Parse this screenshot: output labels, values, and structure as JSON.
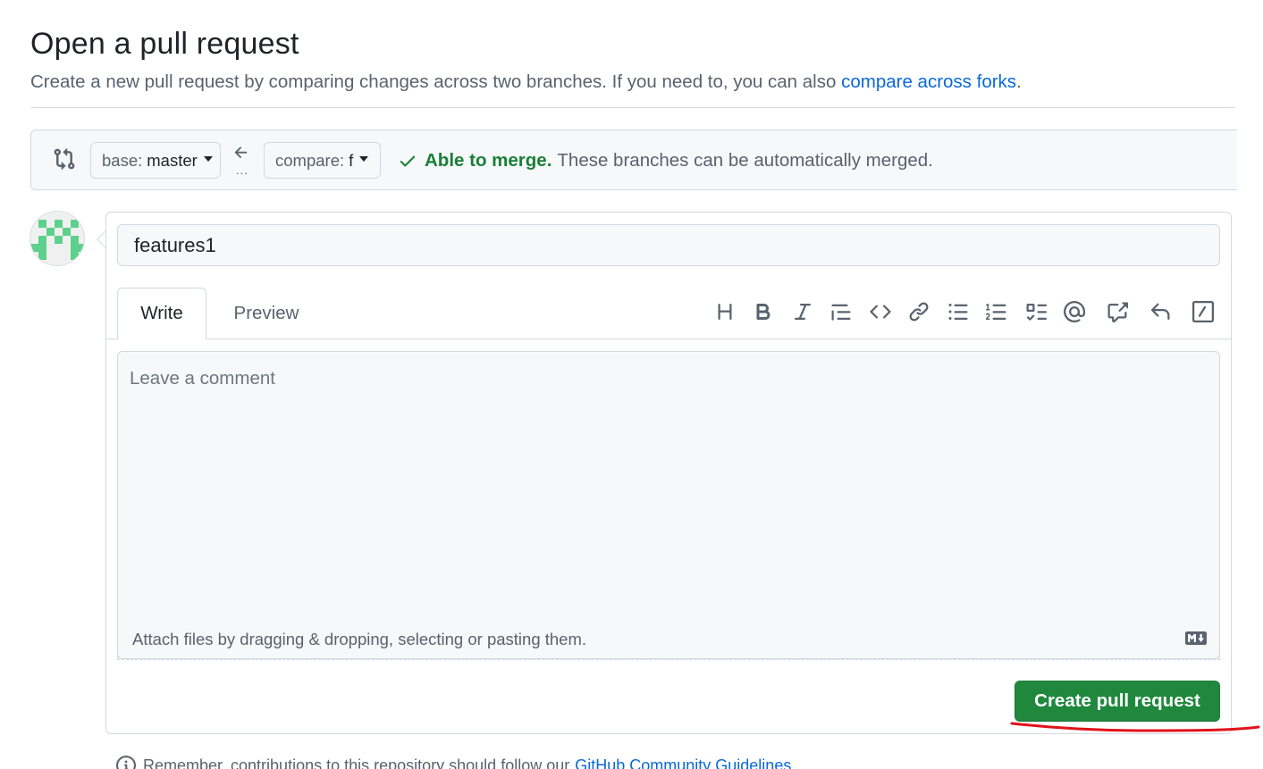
{
  "header": {
    "title": "Open a pull request",
    "subtitle": "Create a new pull request by comparing changes across two branches. If you need to, you can also",
    "compare_link": "compare across forks",
    "subtitle_end": "."
  },
  "range": {
    "base_label": "base:",
    "base_branch": "master",
    "compare_label": "compare:",
    "compare_branch": "f",
    "swap_dots": "...",
    "merge_ok": "Able to merge.",
    "merge_text": "These branches can be automatically merged."
  },
  "form": {
    "title_value": "features1",
    "tabs": [
      {
        "label": "Write",
        "selected": true
      },
      {
        "label": "Preview",
        "selected": false
      }
    ],
    "toolbar_icons": [
      "heading-icon",
      "bold-icon",
      "italic-icon",
      "quote-icon",
      "code-icon",
      "link-icon",
      "unordered-list-icon",
      "ordered-list-icon",
      "task-list-icon",
      "mention-icon",
      "cross-reference-icon",
      "saved-replies-icon",
      "slash-commands-icon"
    ],
    "comment_placeholder": "Leave a comment",
    "attach_text": "Attach files by dragging & dropping, selecting or pasting them.",
    "submit_label": "Create pull request"
  },
  "footer": {
    "note": "Remember, contributions to this repository should follow our",
    "link": "GitHub Community Guidelines"
  },
  "colors": {
    "accent_link": "#0969da",
    "success": "#1a7f37",
    "primary_button": "#1f883d",
    "annotation": "#e0121a"
  }
}
